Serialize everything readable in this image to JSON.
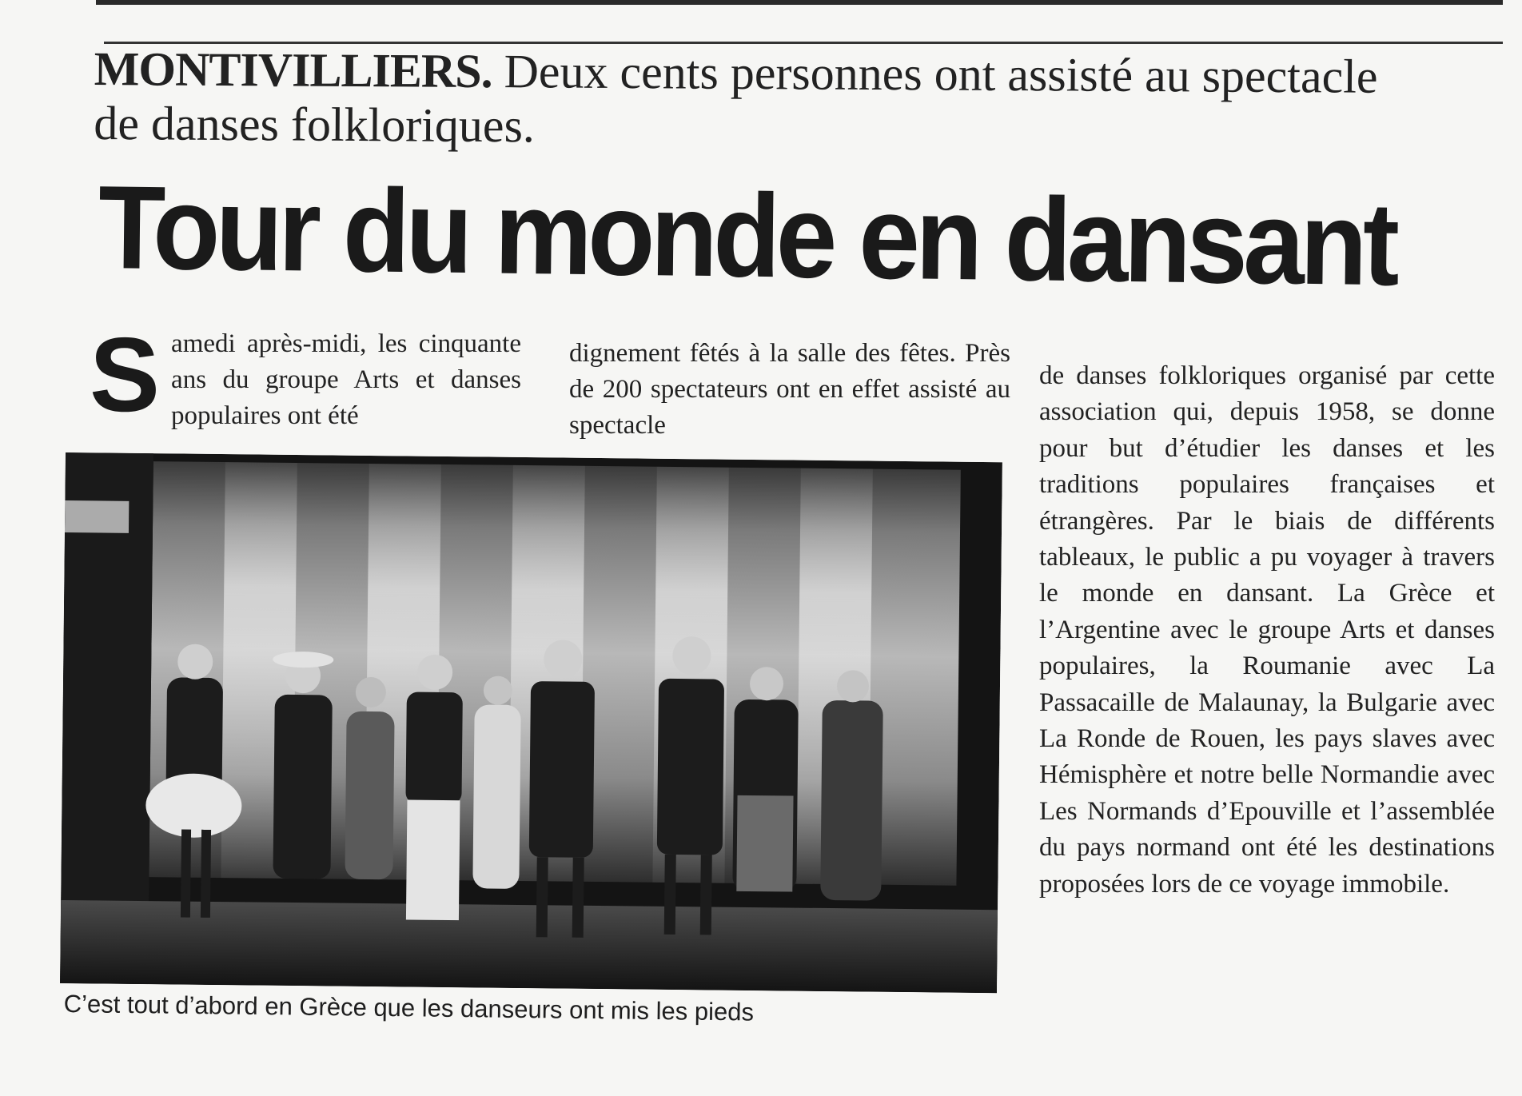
{
  "article": {
    "kicker_city": "MONTIVILLIERS.",
    "kicker_rest": " Deux cents personnes ont assisté au spectacle de danses folkloriques.",
    "headline": "Tour du monde en dansant",
    "dropcap": "S",
    "col1_text": "amedi après-midi, les cinquante ans du groupe Arts et danses populaires ont été",
    "col2_text": "dignement fêtés à la salle des fêtes. Près de 200 spectateurs ont en effet assisté au spectacle",
    "col3_text": "de danses folkloriques organisé par cette association qui, depuis 1958, se donne pour but d’étudier les danses et les traditions populaires françaises et étrangères. Par le biais de différents tableaux, le public a pu voyager à travers le monde en dansant. La Grèce et l’Argentine avec le groupe Arts et danses populaires, la Roumanie avec La Passacaille de Malaunay, la Bulgarie avec La Ronde de Rouen, les pays slaves avec Hémisphère et notre belle Normandie avec Les Normands d’Epouville et l’assemblée du pays normand ont été les destinations proposées lors de ce voyage immobile.",
    "caption": "C’est tout d’abord en Grèce que les danseurs ont mis les pieds"
  },
  "colors": {
    "ink": "#1e1e1e",
    "paper": "#f6f6f4"
  }
}
